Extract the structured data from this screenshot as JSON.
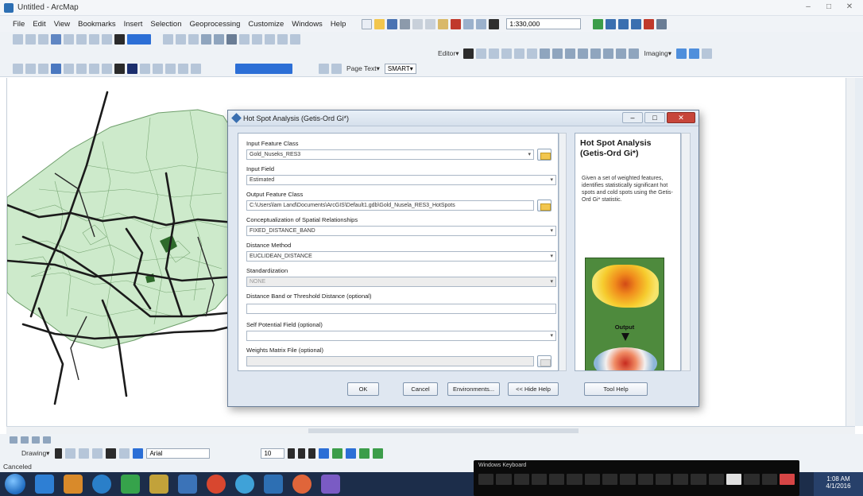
{
  "window": {
    "title": "Untitled - ArcMap",
    "ctrls": [
      "–",
      "□",
      "✕"
    ]
  },
  "menu": [
    "File",
    "Edit",
    "View",
    "Bookmarks",
    "Insert",
    "Selection",
    "Geoprocessing",
    "Customize",
    "Windows",
    "Help"
  ],
  "toolbar": {
    "scale": "1:330,000",
    "editor_label": "Editor▾",
    "imaging_label": "Imaging▾",
    "page_text_label": "Page Text▾",
    "label_dropdown": "SMART▾"
  },
  "dialog": {
    "title": "Hot Spot Analysis (Getis-Ord Gi*)",
    "ctrl_min": "–",
    "ctrl_max": "□",
    "ctrl_close": "✕",
    "params": [
      {
        "label": "Input Feature Class",
        "value": "Gold_Nuseks_RES3",
        "kind": "dropdown-folder"
      },
      {
        "label": "Input Field",
        "value": "Estimated",
        "kind": "dropdown"
      },
      {
        "label": "Output Feature Class",
        "value": "C:\\Users\\lam Land\\Documents\\ArcGIS\\Default1.gdb\\Gold_Nusela_RES3_HotSpots",
        "kind": "folder"
      },
      {
        "label": "Conceptualization of Spatial Relationships",
        "value": "FIXED_DISTANCE_BAND",
        "kind": "dropdown"
      },
      {
        "label": "Distance Method",
        "value": "EUCLIDEAN_DISTANCE",
        "kind": "dropdown"
      },
      {
        "label": "Standardization",
        "value": "NONE",
        "kind": "dropdown-disabled"
      },
      {
        "label": "Distance Band or Threshold Distance (optional)",
        "value": "",
        "kind": "text"
      },
      {
        "label": "Self Potential Field (optional)",
        "value": "",
        "kind": "dropdown"
      },
      {
        "label": "Weights Matrix File (optional)",
        "value": "",
        "kind": "folder-disabled"
      }
    ],
    "buttons": {
      "ok": "OK",
      "cancel": "Cancel",
      "environments": "Environments...",
      "hide_help": "<< Hide Help",
      "tool_help": "Tool Help"
    },
    "help": {
      "title": "Hot Spot Analysis (Getis-Ord Gi*)",
      "body": "Given a set of weighted features, identifies statistically significant hot spots and cold spots using the Getis-Ord Gi* statistic.",
      "image_label": "Output"
    }
  },
  "drawing_toolbar": {
    "label": "Drawing▾",
    "font": "Arial",
    "size": "10"
  },
  "status": {
    "text": "Canceled"
  },
  "taskbar": {
    "clock_time": "1:08 AM",
    "clock_date": "4/1/2016"
  },
  "osk": {
    "label": "Windows Keyboard"
  }
}
